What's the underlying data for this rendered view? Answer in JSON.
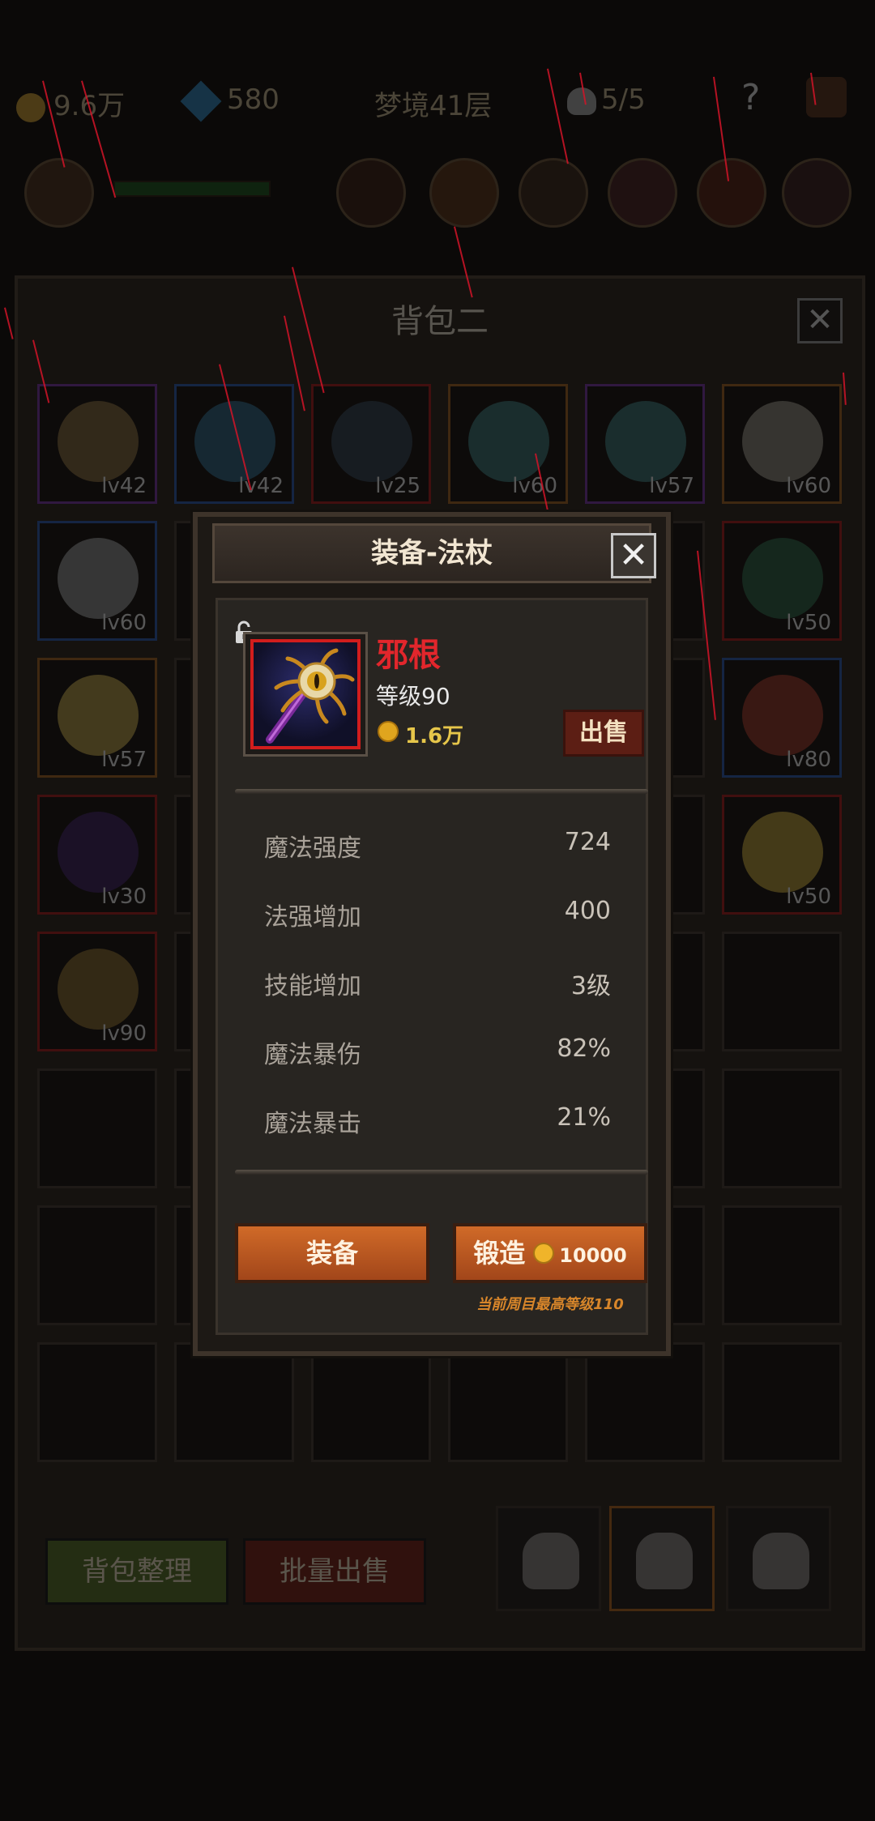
{
  "top_bar": {
    "gold": "9.6万",
    "gems": "580",
    "dungeon_floor": "梦境41层",
    "skull_count": "5/5",
    "help": "?"
  },
  "backpack": {
    "title": "背包二",
    "close_label": "✕",
    "slots": [
      {
        "level": "lv42",
        "rarity": "purple",
        "item_color": "#8a6a3a"
      },
      {
        "level": "lv42",
        "rarity": "blue",
        "item_color": "#2f6a8e"
      },
      {
        "level": "lv25",
        "rarity": "red",
        "item_color": "#3a4a5a"
      },
      {
        "level": "lv60",
        "rarity": "orange",
        "item_color": "#3a7a7a"
      },
      {
        "level": "lv57",
        "rarity": "purple",
        "item_color": "#3a7a7a"
      },
      {
        "level": "lv60",
        "rarity": "orange",
        "item_color": "#8e8a7a"
      },
      {
        "level": "lv60",
        "rarity": "blue",
        "item_color": "#8e8e8e"
      },
      {
        "level": "lv50",
        "rarity": "red",
        "item_color": "#2e6a4a"
      },
      {
        "level": "lv57",
        "rarity": "orange",
        "item_color": "#b69a3a"
      },
      {
        "level": "lv80",
        "rarity": "blue",
        "item_color": "#a83a2a"
      },
      {
        "level": "lv30",
        "rarity": "red",
        "item_color": "#4a2a6e"
      },
      {
        "level": "lv50",
        "rarity": "red",
        "item_color": "#b89a2a"
      },
      {
        "level": "lv90",
        "rarity": "red",
        "item_color": "#8e6a2a"
      }
    ],
    "sort_button": "背包整理",
    "bulk_sell_button": "批量出售"
  },
  "modal": {
    "title": "装备-法杖",
    "close_label": "✕",
    "item": {
      "name": "邪根",
      "level": "等级90",
      "price": "1.6万"
    },
    "sell_button": "出售",
    "stats": [
      {
        "label": "魔法强度",
        "value": "724"
      },
      {
        "label": "法强增加",
        "value": "400"
      },
      {
        "label": "技能增加",
        "value": "3级"
      },
      {
        "label": "魔法暴伤",
        "value": "82%"
      },
      {
        "label": "魔法暴击",
        "value": "21%"
      }
    ],
    "equip_button": "装备",
    "forge_button": "锻造",
    "forge_cost": "10000",
    "max_level_note": "当前周目最高等级110"
  },
  "colors": {
    "rarity_red": "#d11d1d",
    "item_name_red": "#e2262c",
    "button_orange": "#c25e24",
    "rain_red": "#d21428"
  }
}
